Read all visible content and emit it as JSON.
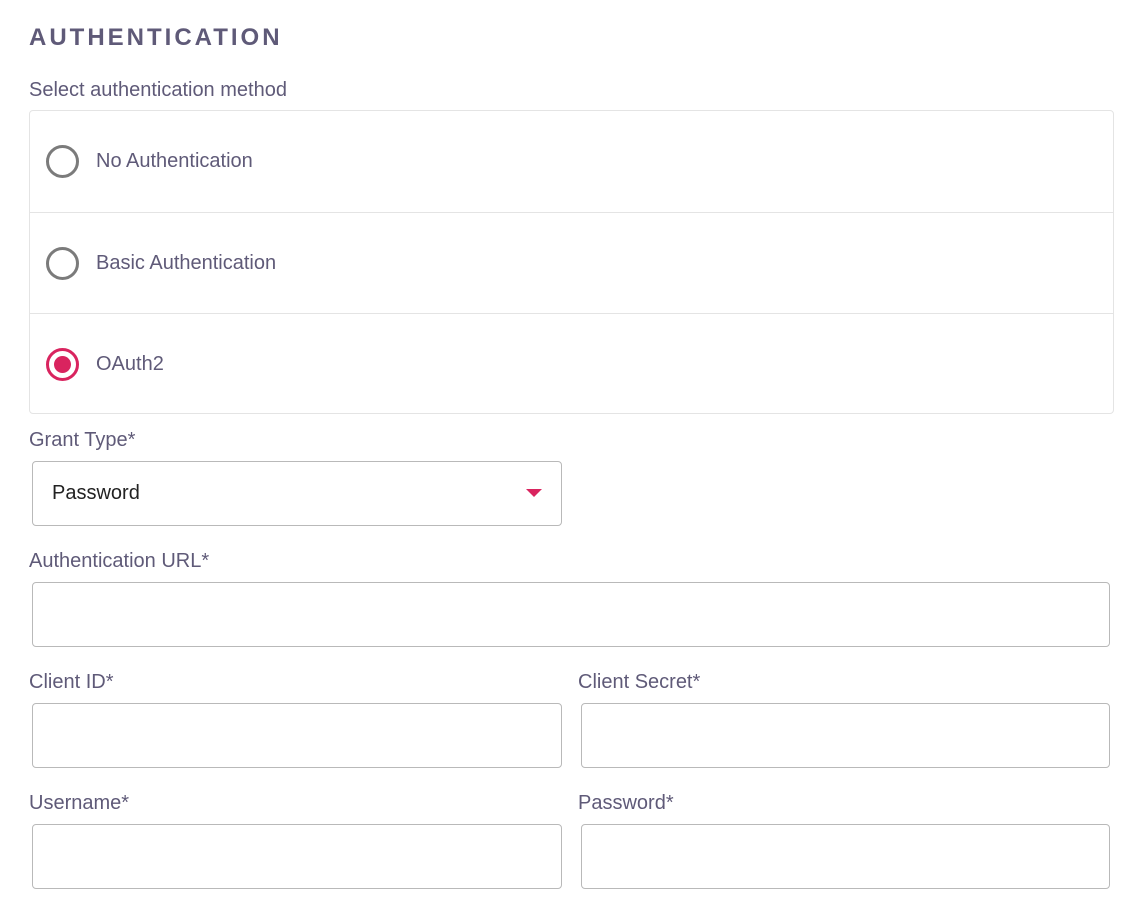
{
  "section": {
    "title": "AUTHENTICATION"
  },
  "method": {
    "label": "Select authentication method",
    "options": [
      {
        "label": "No Authentication",
        "selected": false
      },
      {
        "label": "Basic Authentication",
        "selected": false
      },
      {
        "label": "OAuth2",
        "selected": true
      }
    ]
  },
  "grant_type": {
    "label": "Grant Type*",
    "value": "Password"
  },
  "auth_url": {
    "label": "Authentication URL*",
    "value": ""
  },
  "client_id": {
    "label": "Client ID*",
    "value": ""
  },
  "client_secret": {
    "label": "Client Secret*",
    "value": ""
  },
  "username": {
    "label": "Username*",
    "value": ""
  },
  "password": {
    "label": "Password*",
    "value": ""
  },
  "colors": {
    "accent": "#d9245f",
    "label_text": "#5f5a78",
    "border": "#b9b9b9"
  },
  "icons": {
    "dropdown": "chevron-down-icon",
    "radio_selected": "radio-selected-icon",
    "radio_unselected": "radio-unselected-icon"
  }
}
